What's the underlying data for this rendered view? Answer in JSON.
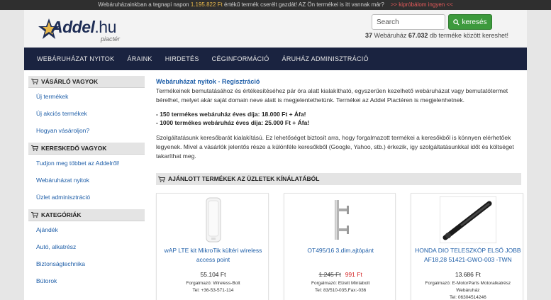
{
  "topbar": {
    "text_before": "Webáruházainkban a tegnapi napon ",
    "amount": "1.195.822 Ft",
    "text_after": " értékű termék cserélt gazdát! AZ Ön termékei is itt vannak már?",
    "try_link": ">> kipróbálom ingyen <<"
  },
  "header": {
    "logo_text": "Addel",
    "logo_domain": ".hu",
    "logo_sub": "piactér",
    "search_placeholder": "Search",
    "search_button": "keresés",
    "stats_count": "37",
    "stats_text1": " Webáruház ",
    "stats_products": "67.032",
    "stats_text2": " db terméke között kereshet!"
  },
  "nav": {
    "items": [
      "WEBÁRUHÁZAT NYITOK",
      "ÁRAINK",
      "HIRDETÉS",
      "CÉGINFORMÁCIÓ",
      "ÁRUHÁZ ADMINISZTRÁCIÓ"
    ]
  },
  "sidebar": {
    "buyer_head": "VÁSÁRLÓ VAGYOK",
    "buyer_items": [
      "Új termékek",
      "Új akciós termékek",
      "Hogyan vásároljon?"
    ],
    "seller_head": "KERESKEDŐ VAGYOK",
    "seller_items": [
      "Tudjon meg többet az Addelről!",
      "Webáruházat nyitok",
      "Üzlet adminisztráció"
    ],
    "cat_head": "KATEGÓRIÁK",
    "cat_items": [
      "Ajándék",
      "Autó, alkatrész",
      "Biztonságtechnika",
      "Bútorok"
    ]
  },
  "main": {
    "title": "Webáruházat nyitok - Regisztráció",
    "intro": "Termékeinek bemutatásához és értékesítéséhez pár óra alatt kialakítható, egyszerűen kezelhető webáruházat vagy bemutatótermet bérelhet, melyet akár saját domain neve alatt is megjelentethetünk. Termékei az Addel Piactéren is megjelenhetnek.",
    "price1": "- 150 termékes webáruház éves díja: 18.000 Ft + Áfa!",
    "price2": "- 1000 termékes webáruház éves díja: 25.000 Ft + Áfa!",
    "service": "Szolgáltatásunk keresőbarát kialakítású. Ez lehetőséget biztosít arra, hogy forgalmazott termékei a keresőkből is könnyen elérhetőek legyenek. Mivel a vásárlók jelentős része a különféle keresőkből (Google, Yahoo, stb.) érkezik, így szolgáltatásunkkal időt és költséget takaríthat meg.",
    "offer_head": "AJÁNLOTT TERMÉKEK AZ ÜZLETEK KÍNÁLATÁBÓL"
  },
  "products": [
    {
      "title": "wAP LTE kit MikroTik kültéri wireless access point",
      "price": "55.104 Ft",
      "seller_line1": "Forgalmazó: Wireless-Bolt",
      "seller_line2": "Tel: +36-53-571-114",
      "image": "router-image"
    },
    {
      "title": "OT495/16 3.dim.ajtópánt",
      "old_price": "1.245 Ft",
      "price": "991 Ft",
      "seller_line1": "Forgalmazó: Elzett Mintabolt",
      "seller_line2": "Tel: 83/510-035,Fax:-036",
      "image": "hinge-image"
    },
    {
      "title": "HONDA DIO TELESZKÓP ELSŐ JOBB AF18,28 51421-GWO-003 -TWN",
      "price": "13.686 Ft",
      "seller_line1": "Forgalmazó: E-MotorParts Motoralkatrész Webáruház",
      "seller_line2": "Tel: 06304514246",
      "image": "fork-image"
    }
  ],
  "colors": {
    "nav_bg": "#1a2340",
    "link": "#1e5ea8",
    "search_btn": "#3d9a3d",
    "sale_price": "#d32020"
  }
}
